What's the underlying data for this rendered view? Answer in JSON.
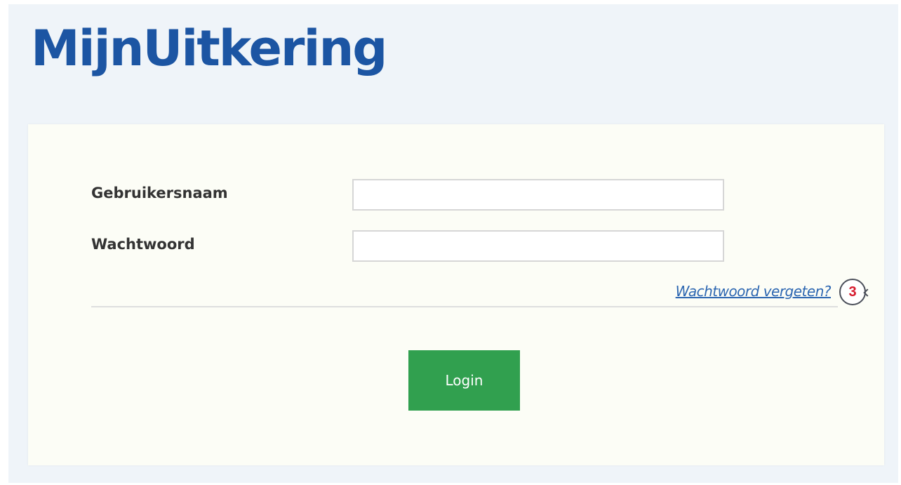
{
  "header": {
    "logo_text": "MijnUitkering"
  },
  "form": {
    "username_label": "Gebruikersnaam",
    "username_value": "",
    "password_label": "Wachtwoord",
    "password_value": "",
    "forgot_password_link": "Wachtwoord vergeten?",
    "annotation_marker": "3",
    "login_button": "Login"
  },
  "colors": {
    "brand_blue": "#1c55a3",
    "link_blue": "#2c66b1",
    "login_green": "#31a04f",
    "marker_red": "#d61a2d",
    "page_background": "#eff4f9",
    "card_background": "#fcfdf6"
  }
}
